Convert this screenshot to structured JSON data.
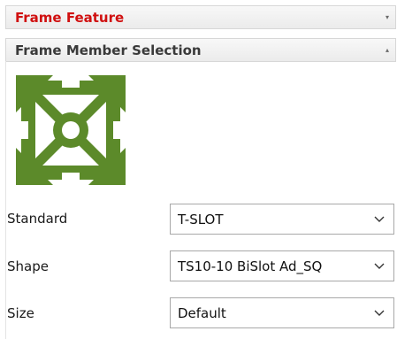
{
  "panels": {
    "frame_feature": {
      "title": "Frame Feature",
      "caret": "▾"
    },
    "member_selection": {
      "title": "Frame Member Selection",
      "caret": "▴"
    }
  },
  "logo": {
    "icon": "frame-member-icon",
    "color": "#5c8a2a"
  },
  "fields": [
    {
      "label": "Standard",
      "value": "T-SLOT"
    },
    {
      "label": "Shape",
      "value": "TS10-10 BiSlot Ad_SQ"
    },
    {
      "label": "Size",
      "value": "Default"
    }
  ],
  "colors": {
    "section_title_red": "#d01010",
    "accent_green": "#5c8a2a"
  }
}
